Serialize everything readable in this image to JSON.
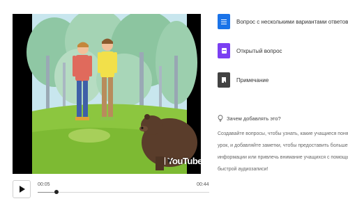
{
  "video": {
    "current_time": "00:05",
    "duration": "00:44",
    "progress": 0.11,
    "brand": "YouTube"
  },
  "options": [
    {
      "label": "Вопрос с несколькими вариантами ответов",
      "icon": "list-icon",
      "color": "#1a73e8"
    },
    {
      "label": "Открытый вопрос",
      "icon": "open-question-icon",
      "color": "#7b3ff2"
    },
    {
      "label": "Примечание",
      "icon": "note-icon",
      "color": "#424242"
    }
  ],
  "why": {
    "title": "Зачем добавлять это?",
    "body": "Создавайте вопросы, чтобы узнать, какие учащиеся поняли урок, и добавляйте заметки, чтобы предоставить больше информации или привлечь внимание учащихся с помощью быстрой аудиозаписи!"
  }
}
